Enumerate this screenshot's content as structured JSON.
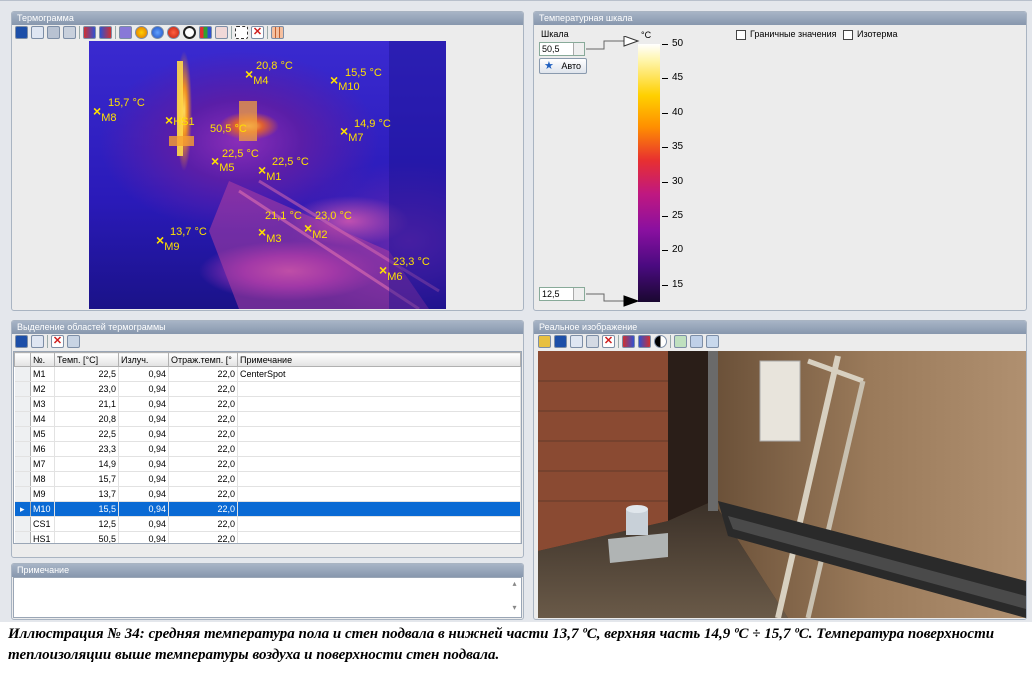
{
  "thermogram": {
    "title": "Термограмма",
    "markers": [
      {
        "label": "M1",
        "temp": "22,5 °C"
      },
      {
        "label": "M2",
        "temp": "23,0 °C"
      },
      {
        "label": "M3",
        "temp": "21,1 °C"
      },
      {
        "label": "M4",
        "temp": "20,8 °C"
      },
      {
        "label": "M5",
        "temp": "22,5 °C"
      },
      {
        "label": "M6",
        "temp": "23,3 °C"
      },
      {
        "label": "M7",
        "temp": "14,9 °C"
      },
      {
        "label": "M8",
        "temp": "15,7 °C"
      },
      {
        "label": "M9",
        "temp": "13,7 °C"
      },
      {
        "label": "M10",
        "temp": "15,5 °C"
      },
      {
        "label": "HS1",
        "temp": "50,5 °C"
      }
    ]
  },
  "scale": {
    "title": "Температурная шкала",
    "scale_label": "Шкала",
    "max_value": "50,5",
    "min_value": "12,5",
    "auto_button": "Авто",
    "unit": "°C",
    "ticks": [
      "50",
      "45",
      "40",
      "35",
      "30",
      "25",
      "20",
      "15"
    ],
    "boundary_label": "Граничные значения",
    "isotherm_label": "Изотерма",
    "colors": {
      "hot": "#ffffff",
      "mid": "#e83030",
      "cold": "#1a0830"
    }
  },
  "regions": {
    "title": "Выделение областей термограммы",
    "columns": [
      "№.",
      "Темп. [°C]",
      "Излуч.",
      "Отраж.темп. [°",
      "Примечание"
    ],
    "rows": [
      {
        "id": "M1",
        "temp": "22,5",
        "emis": "0,94",
        "refl": "22,0",
        "note": "CenterSpot"
      },
      {
        "id": "M2",
        "temp": "23,0",
        "emis": "0,94",
        "refl": "22,0",
        "note": ""
      },
      {
        "id": "M3",
        "temp": "21,1",
        "emis": "0,94",
        "refl": "22,0",
        "note": ""
      },
      {
        "id": "M4",
        "temp": "20,8",
        "emis": "0,94",
        "refl": "22,0",
        "note": ""
      },
      {
        "id": "M5",
        "temp": "22,5",
        "emis": "0,94",
        "refl": "22,0",
        "note": ""
      },
      {
        "id": "M6",
        "temp": "23,3",
        "emis": "0,94",
        "refl": "22,0",
        "note": ""
      },
      {
        "id": "M7",
        "temp": "14,9",
        "emis": "0,94",
        "refl": "22,0",
        "note": ""
      },
      {
        "id": "M8",
        "temp": "15,7",
        "emis": "0,94",
        "refl": "22,0",
        "note": ""
      },
      {
        "id": "M9",
        "temp": "13,7",
        "emis": "0,94",
        "refl": "22,0",
        "note": ""
      },
      {
        "id": "M10",
        "temp": "15,5",
        "emis": "0,94",
        "refl": "22,0",
        "note": ""
      },
      {
        "id": "CS1",
        "temp": "12,5",
        "emis": "0,94",
        "refl": "22,0",
        "note": ""
      },
      {
        "id": "HS1",
        "temp": "50,5",
        "emis": "0,94",
        "refl": "22,0",
        "note": ""
      }
    ],
    "selected_id": "M10"
  },
  "note_panel": {
    "title": "Примечание"
  },
  "real_image": {
    "title": "Реальное изображение"
  },
  "caption": "Иллюстрация № 34: средняя температура пола и стен подвала в нижней части 13,7 ºС, верхняя часть 14,9 ºС ÷ 15,7 ºС. Температура поверхности теплоизоляции выше температуры воздуха и поверхности стен подвала."
}
